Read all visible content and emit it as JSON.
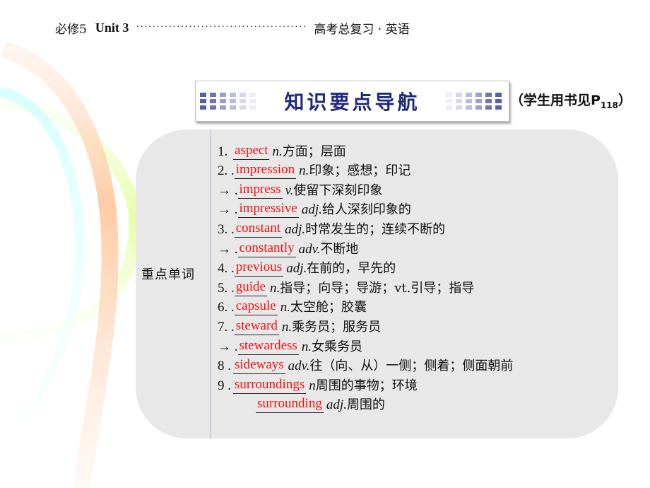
{
  "header": {
    "book": "必修5",
    "unit": "Unit  3",
    "dots": "··········································",
    "series": "高考总复习 · 英语"
  },
  "banner": {
    "title": "知识要点导航",
    "reference_prefix": "（学生用书见P",
    "reference_page": "118",
    "reference_suffix": "）",
    "accent_color": "#1f2a7a"
  },
  "section": {
    "label": "重点单词"
  },
  "vocabulary": [
    {
      "prefix": "1.",
      "answer": "aspect",
      "pos": "n.",
      "definition": "方面；层面"
    },
    {
      "prefix": "2. .",
      "answer": "impression",
      "pos": "n.",
      "definition": "印象；感想；印记"
    },
    {
      "prefix": "→ .",
      "answer": "impress",
      "pos": "v.",
      "definition": "使留下深刻印象"
    },
    {
      "prefix": "→ .",
      "answer": "impressive",
      "pos": "adj.",
      "definition": "给人深刻印象的"
    },
    {
      "prefix": "3. .",
      "answer": "constant",
      "pos": "adj.",
      "definition": "时常发生的；连续不断的"
    },
    {
      "prefix": "→ .",
      "answer": "constantly",
      "pos": "adv.",
      "definition": "不断地"
    },
    {
      "prefix": "4. .",
      "answer": "previous",
      "pos": "adj.",
      "definition": "在前的，早先的"
    },
    {
      "prefix": "5. .",
      "answer": "guide",
      "pos": "n.",
      "definition": "指导；向导；导游；vt.引导；指导"
    },
    {
      "prefix": "6. .",
      "answer": "capsule",
      "pos": "n.",
      "definition": "太空舱；胶囊"
    },
    {
      "prefix": "7. .",
      "answer": "steward",
      "pos": "n.",
      "definition": "乘务员；服务员"
    },
    {
      "prefix": "→ .",
      "answer": "stewardess",
      "pos": "n.",
      "definition": "女乘务员"
    },
    {
      "prefix": "8 .",
      "answer": "sideways",
      "pos": "adv.",
      "definition": "往（向、从）一侧；侧着；侧面朝前"
    },
    {
      "prefix": " 9 .",
      "answer": "surroundings",
      "pos": "n ",
      "definition": "周围的事物；环境"
    },
    {
      "prefix": "",
      "answer": "surrounding",
      "pos": "adj.",
      "definition": "周围的"
    }
  ],
  "colors": {
    "answer": "#f01010",
    "panel": "#e8e8e8"
  }
}
